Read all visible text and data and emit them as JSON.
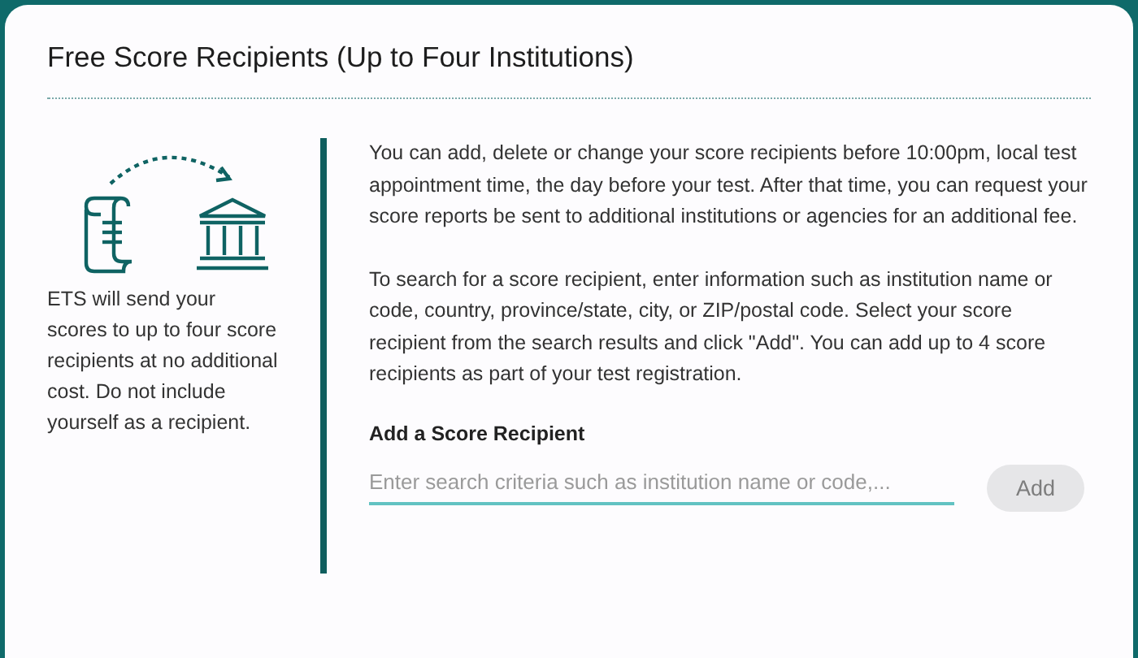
{
  "card": {
    "title": "Free Score Recipients (Up to Four Institutions)"
  },
  "sidebar": {
    "note": "ETS will send your scores to up to four score recipients at no additional cost. Do not include yourself as a recipient."
  },
  "paragraphs": [
    "You can add, delete or change your score recipients before 10:00pm, local test appointment time, the day before your test. After that time, you can request your score reports be sent to additional institutions or agencies for an additional fee.",
    "To search for a score recipient, enter information such as institution name or code, country, province/state, city, or ZIP/postal code. Select your score recipient from the search results and click \"Add\". You can add up to 4 score recipients as part of your test registration."
  ],
  "add_recipient": {
    "label": "Add a Score Recipient",
    "placeholder": "Enter search criteria such as institution name or code,...",
    "button": {
      "label": "Add",
      "disabled": true
    }
  }
}
